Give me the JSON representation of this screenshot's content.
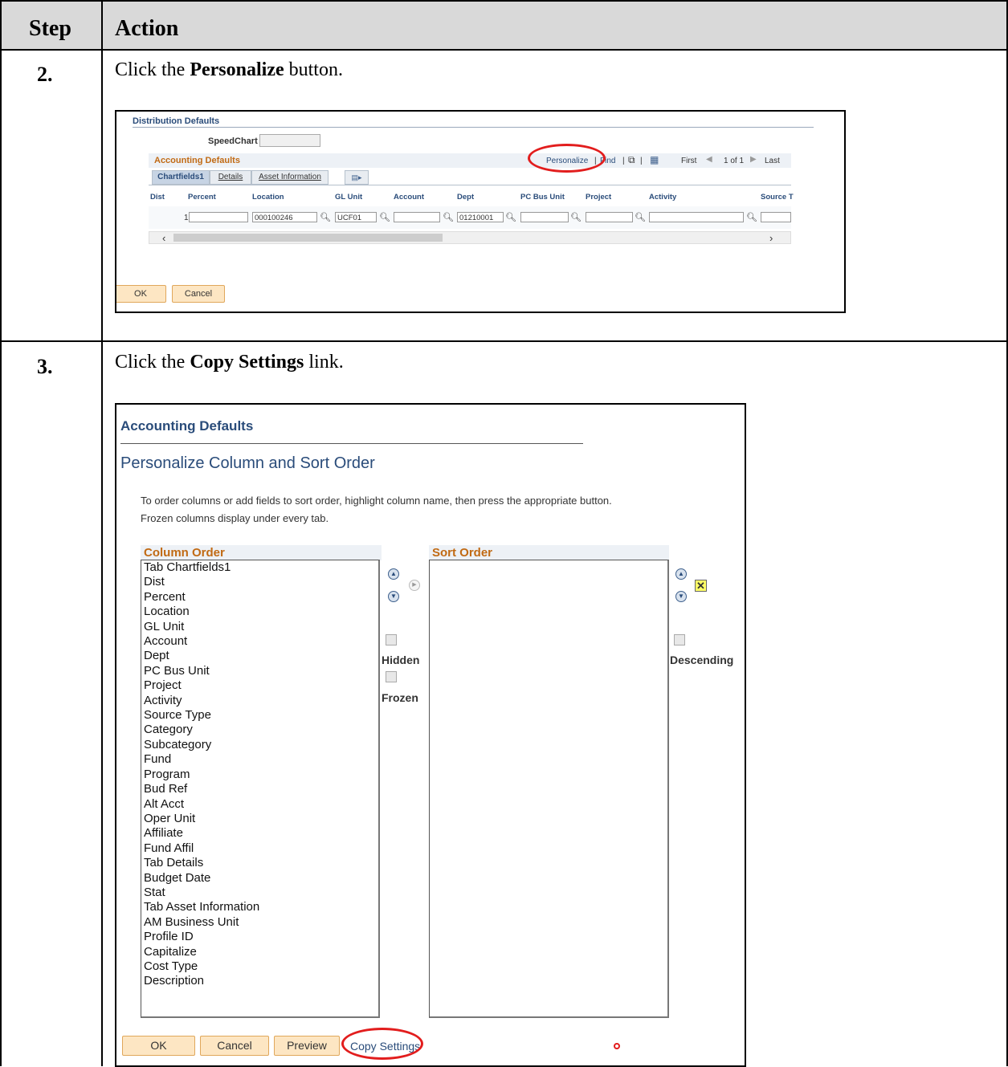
{
  "table": {
    "header_step": "Step",
    "header_action": "Action"
  },
  "steps": [
    {
      "num": "2.",
      "prefix": "Click the ",
      "bold": "Personalize",
      "suffix": " button."
    },
    {
      "num": "3.",
      "prefix": "Click the ",
      "bold": "Copy Settings",
      "suffix": " link."
    }
  ],
  "screen1": {
    "title": "Distribution Defaults",
    "speedchart_label": "SpeedChart",
    "grid_title": "Accounting Defaults",
    "toolbar": {
      "personalize": "Personalize",
      "sep1": "|",
      "find": "Find",
      "sep2": "|",
      "first": "First",
      "count": "1 of 1",
      "last": "Last"
    },
    "tabs": [
      "Chartfields1",
      "Details",
      "Asset Information"
    ],
    "columns": [
      "Dist",
      "Percent",
      "Location",
      "GL Unit",
      "Account",
      "Dept",
      "PC Bus Unit",
      "Project",
      "Activity",
      "Source T"
    ],
    "row": {
      "dist": "1",
      "percent": "",
      "location": "000100246",
      "gl_unit": "UCF01",
      "account": "",
      "dept": "01210001",
      "pc_bus_unit": "",
      "project": "",
      "activity": "",
      "source": ""
    },
    "buttons": {
      "ok": "OK",
      "cancel": "Cancel"
    }
  },
  "screen2": {
    "title": "Accounting Defaults",
    "heading": "Personalize Column and Sort Order",
    "instruction1": "To order columns or add fields to sort order, highlight column name, then press the appropriate button.",
    "instruction2": "Frozen columns display under every tab.",
    "column_order_label": "Column Order",
    "sort_order_label": "Sort Order",
    "column_items": [
      "Tab Chartfields1",
      "Dist",
      "Percent",
      "Location",
      "GL Unit",
      "Account",
      "Dept",
      "PC Bus Unit",
      "Project",
      "Activity",
      "Source Type",
      "Category",
      "Subcategory",
      "Fund",
      "Program",
      "Bud Ref",
      "Alt Acct",
      "Oper Unit",
      "Affiliate",
      "Fund Affil",
      "Tab Details",
      "Budget Date",
      "Stat",
      "Tab Asset Information",
      "AM Business Unit",
      "Profile ID",
      "Capitalize",
      "Cost Type",
      "Description"
    ],
    "hidden_label": "Hidden",
    "frozen_label": "Frozen",
    "descending_label": "Descending",
    "buttons": {
      "ok": "OK",
      "cancel": "Cancel",
      "preview": "Preview",
      "copy_settings": "Copy Settings"
    }
  },
  "colors": {
    "highlight_ellipse": "#e21d1d",
    "link_blue": "#2a4c7a",
    "section_orange": "#c16a14",
    "button_fill": "#fde6c3",
    "header_gray": "#d9d9d9"
  }
}
